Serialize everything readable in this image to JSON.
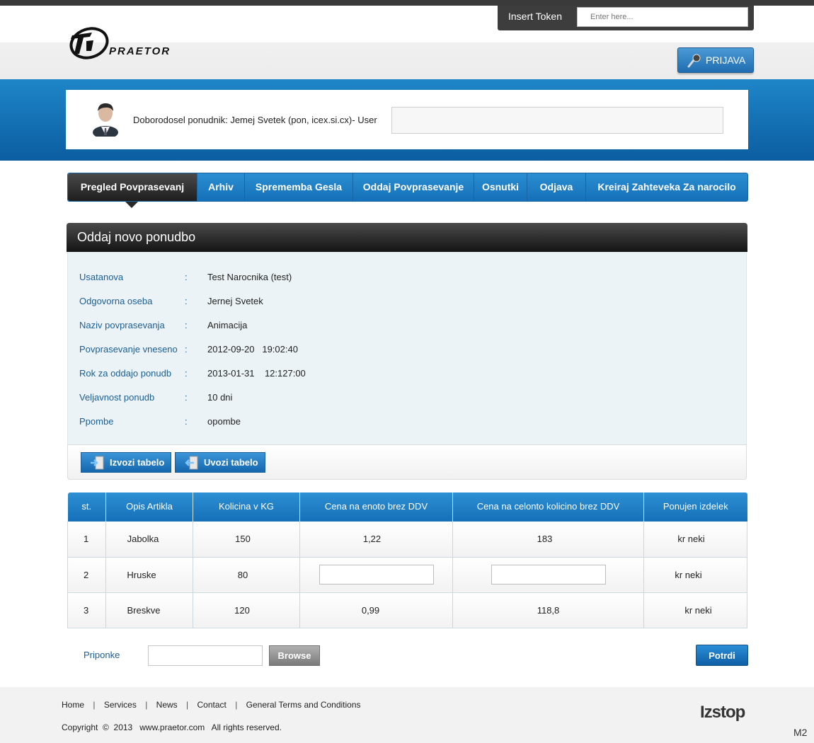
{
  "header": {
    "logo_text": "PRAETOR",
    "token": {
      "label": "Insert Token",
      "placeholder": "Enter here..."
    },
    "login_label": "PRIJAVA"
  },
  "welcome": {
    "text": "Doborodosel ponudnik: Jemej Svetek (pon, icex.si.cx)- User"
  },
  "nav": {
    "items": [
      {
        "label": "Pregled Povprasevanj",
        "active": true
      },
      {
        "label": "Arhiv"
      },
      {
        "label": "Sprememba Gesla"
      },
      {
        "label": "Oddaj Povprasevanje"
      },
      {
        "label": "Osnutki"
      },
      {
        "label": "Odjava"
      },
      {
        "label": "Kreiraj Zahteveka Za narocilo"
      }
    ]
  },
  "panel": {
    "title": "Oddaj novo ponudbo",
    "fields": [
      {
        "label": "Usatanova",
        "value": "Test Narocnika (test)"
      },
      {
        "label": "Odgovorna oseba",
        "value": "Jernej Svetek"
      },
      {
        "label": "Naziv povprasevanja",
        "value": "Animacija"
      },
      {
        "label": "Povprasevanje vneseno",
        "value": "2012-09-20   19:02:40"
      },
      {
        "label": "Rok za oddajo ponudb",
        "value": "2013-01-31    12:127:00"
      },
      {
        "label": "Veljavnost ponudb",
        "value": "10 dni"
      },
      {
        "label": "Ppombe",
        "value": "opombe"
      }
    ],
    "colon": ":",
    "export_label": "Izvozi tabelo",
    "import_label": "Uvozi tabelo"
  },
  "table": {
    "headers": [
      "st.",
      "Opis Artikla",
      "Kolicina v KG",
      "Cena na enoto brez DDV",
      "Cena na celonto kolicino brez DDV",
      "Ponujen izdelek"
    ],
    "rows": [
      [
        "1",
        "Jabolka",
        "150",
        "1,22",
        "183",
        "kr neki"
      ],
      [
        "2",
        "Hruske",
        "80",
        "",
        "",
        "kr neki"
      ],
      [
        "3",
        "Breskve",
        "120",
        "0,99",
        "118,8",
        "kr neki"
      ]
    ]
  },
  "attachments": {
    "label": "Priponke",
    "browse_label": "Browse",
    "confirm_label": "Potrdi"
  },
  "footer": {
    "links": [
      "Home",
      "Services",
      "News",
      "Contact",
      "General Terms and Conditions"
    ],
    "separator": "|",
    "copyright": "Copyright  ©  2013   www.praetor.com   All rights reserved.",
    "logo_text": "Izstop",
    "corner_tag": "M2"
  },
  "colors": {
    "brand_blue": "#1470b8",
    "dark_bar": "#1e1e1e",
    "label_blue": "#1a5e96",
    "panel_bg": "#ecf3f6"
  }
}
